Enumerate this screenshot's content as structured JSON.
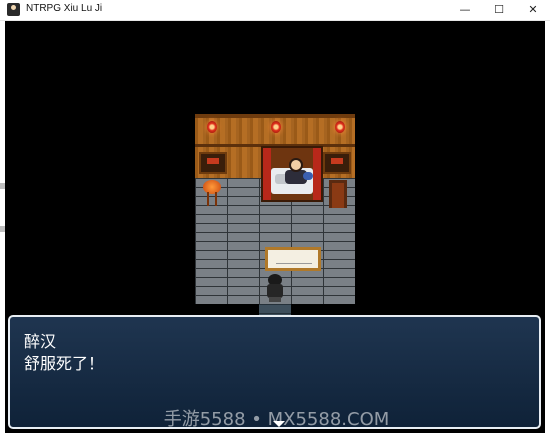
{
  "window": {
    "title": "NTRPG Xiu Lu Ji",
    "min_glyph": "—",
    "max_glyph": "☐",
    "close_glyph": "✕"
  },
  "dialog": {
    "speaker": "醉汉",
    "text": "舒服死了！",
    "watermark": "手游5588 • MX5588.COM"
  },
  "colors": {
    "dialog_bg": "#1f3550",
    "dialog_border": "#e8eef4",
    "wall": "#b56e24",
    "floor": "#7a8086",
    "lantern": "#e0301c"
  },
  "icons": [
    "app-icon",
    "lantern-icon",
    "continue-arrow-icon"
  ]
}
